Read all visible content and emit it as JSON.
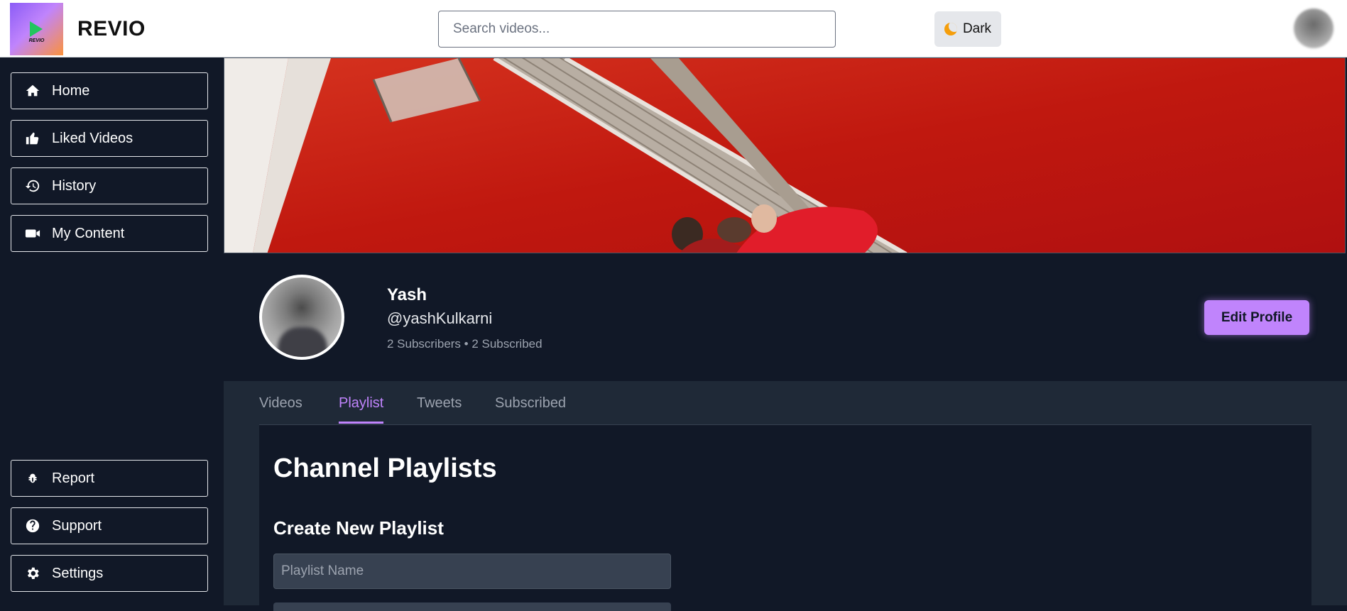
{
  "header": {
    "brand": "REVIO",
    "logo_text": "REVIO",
    "search_placeholder": "Search videos...",
    "theme_label": "Dark"
  },
  "sidebar": {
    "top_items": [
      {
        "label": "Home",
        "icon": "home-icon"
      },
      {
        "label": "Liked Videos",
        "icon": "thumbs-up-icon"
      },
      {
        "label": "History",
        "icon": "history-icon"
      },
      {
        "label": "My Content",
        "icon": "video-camera-icon"
      }
    ],
    "bottom_items": [
      {
        "label": "Report",
        "icon": "bug-icon"
      },
      {
        "label": "Support",
        "icon": "question-circle-icon"
      },
      {
        "label": "Settings",
        "icon": "gear-icon"
      }
    ]
  },
  "profile": {
    "name": "Yash",
    "handle": "@yashKulkarni",
    "stats": "2 Subscribers • 2 Subscribed",
    "edit_button": "Edit Profile"
  },
  "tabs": [
    {
      "label": "Videos",
      "active": false
    },
    {
      "label": "Playlist",
      "active": true
    },
    {
      "label": "Tweets",
      "active": false
    },
    {
      "label": "Subscribed",
      "active": false
    }
  ],
  "playlists": {
    "title": "Channel Playlists",
    "create_heading": "Create New Playlist",
    "name_placeholder": "Playlist Name"
  },
  "colors": {
    "accent": "#c084fc",
    "background": "#111827",
    "panel": "#1f2937",
    "cover_red": "#c81e1e"
  }
}
